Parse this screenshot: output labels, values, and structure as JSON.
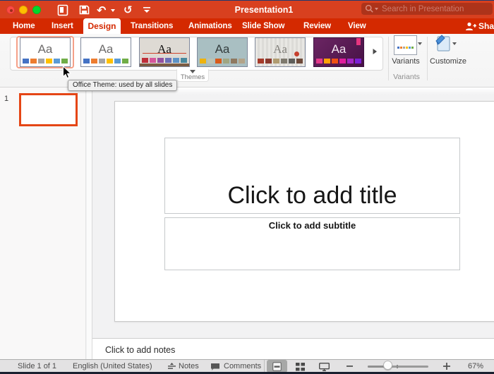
{
  "titlebar": {
    "title": "Presentation1",
    "search_placeholder": "Search in Presentation"
  },
  "tabs": [
    {
      "label": "Home"
    },
    {
      "label": "Insert"
    },
    {
      "label": "Design",
      "active": true
    },
    {
      "label": "Transitions"
    },
    {
      "label": "Animations"
    },
    {
      "label": "Slide Show"
    },
    {
      "label": "Review"
    },
    {
      "label": "View"
    }
  ],
  "share_label": "Sha",
  "ribbon": {
    "themes": [
      {
        "letters": "Aa",
        "selected": true,
        "palette": [
          "#4472c4",
          "#ed7d31",
          "#a5a5a5",
          "#ffc000",
          "#5b9bd5",
          "#70ad47"
        ]
      },
      {
        "letters": "Aa",
        "palette": [
          "#4472c4",
          "#ed7d31",
          "#a5a5a5",
          "#ffc000",
          "#5b9bd5",
          "#70ad47"
        ]
      },
      {
        "letters": "Aa",
        "palette": [
          "#be2e38",
          "#d6569b",
          "#9350a1",
          "#6a6fb8",
          "#5c92c6",
          "#46889d"
        ]
      },
      {
        "letters": "Aa",
        "palette": [
          "#eeb30e",
          "#bcc4b4",
          "#d85a1a",
          "#a0a682",
          "#8e7960",
          "#b3a489"
        ]
      },
      {
        "letters": "Aa",
        "palette": [
          "#a63b2a",
          "#8b3a2e",
          "#b09c71",
          "#7e7a6e",
          "#5f5f5b",
          "#6e4a3a"
        ]
      },
      {
        "letters": "Aa",
        "palette": [
          "#e6398b",
          "#fea106",
          "#f05014",
          "#e01e9c",
          "#a426c4",
          "#7b1fd6"
        ]
      }
    ],
    "themes_button_label": "Themes",
    "variants_label": "Variants",
    "variants_group_label": "Variants",
    "customize_label": "Customize",
    "tooltip": "Office Theme: used by all slides"
  },
  "slide_panel": {
    "slide_number": "1"
  },
  "slide": {
    "title_placeholder": "Click to add title",
    "subtitle_placeholder": "Click to add subtitle"
  },
  "notes_placeholder": "Click to add notes",
  "statusbar": {
    "slide_count": "Slide 1 of 1",
    "language": "English (United States)",
    "notes_label": "Notes",
    "comments_label": "Comments",
    "zoom_value": "67%"
  }
}
